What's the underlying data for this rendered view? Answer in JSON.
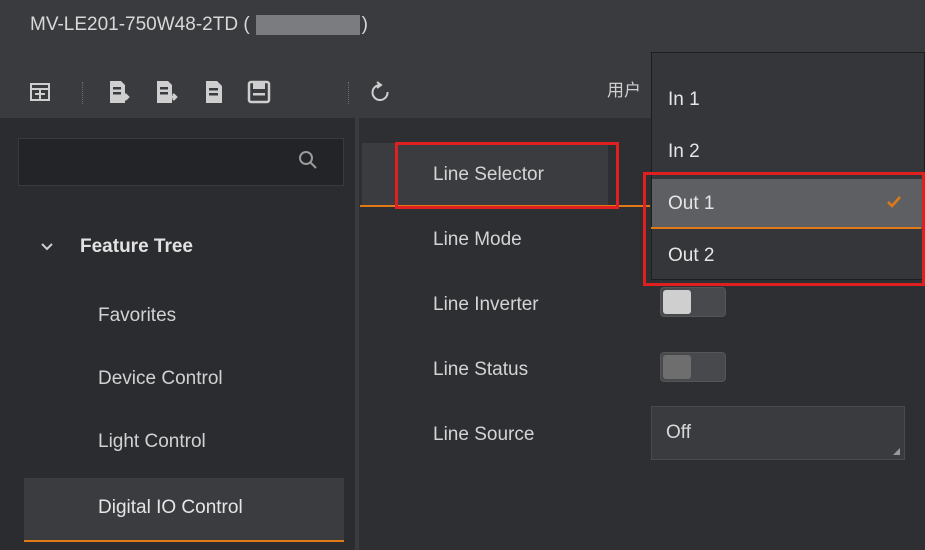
{
  "window": {
    "title_prefix": "MV-LE201-750W48-2TD (",
    "title_suffix": ")"
  },
  "toolbar": {
    "user_label": "用户"
  },
  "icons": [
    "grid-icon",
    "load-feature-icon",
    "save-feature-icon",
    "document-icon",
    "floppy-save-icon",
    "refresh-icon",
    "search-icon",
    "chevron-down-icon",
    "check-icon"
  ],
  "colors": {
    "accent": "#e07a16",
    "highlight": "#e02020",
    "background": "#2e2f32"
  },
  "sidebar": {
    "search_placeholder": "",
    "tree_title": "Feature Tree",
    "items": [
      {
        "label": "Favorites"
      },
      {
        "label": "Device Control"
      },
      {
        "label": "Light Control"
      },
      {
        "label": "Digital IO Control",
        "selected": true
      }
    ]
  },
  "properties": {
    "line_selector": "Line Selector",
    "line_mode": "Line Mode",
    "line_inverter": "Line Inverter",
    "line_status": "Line Status",
    "line_source": "Line Source",
    "line_source_value": "Off"
  },
  "dropdown": {
    "options": [
      {
        "label": "In 1"
      },
      {
        "label": "In 2"
      },
      {
        "label": "Out 1",
        "selected": true
      },
      {
        "label": "Out 2"
      }
    ]
  }
}
